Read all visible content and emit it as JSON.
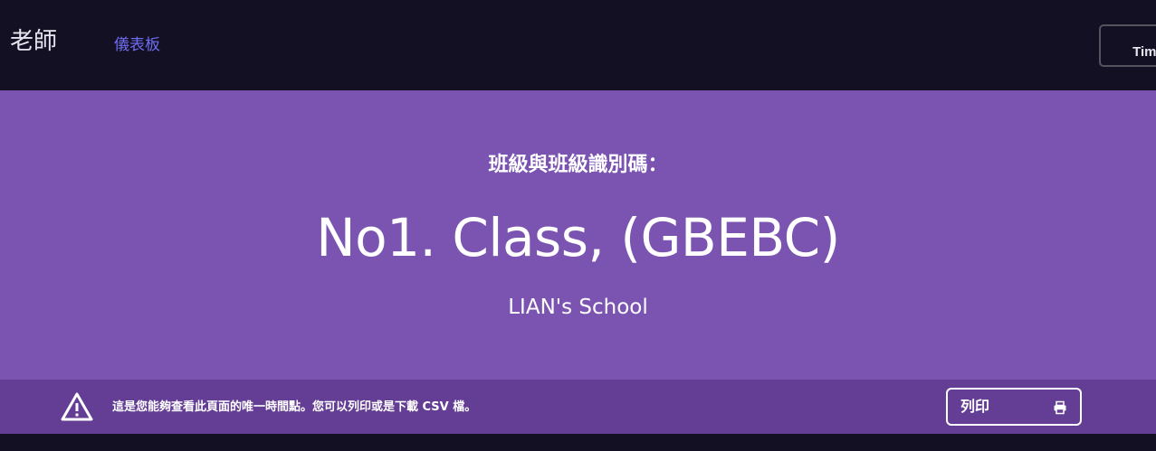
{
  "navbar": {
    "brand": "老師",
    "links": [
      {
        "label": "儀表板"
      }
    ],
    "user_button": "Timy"
  },
  "hero": {
    "label": "班級與班級識別碼：",
    "class_name": "No1. Class, (GBEBC)",
    "school": "LIAN's School"
  },
  "notice": {
    "icon": "warning-icon",
    "text": "這是您能夠查看此頁面的唯一時間點。您可以列印或是下載 CSV 檔。",
    "print_button": {
      "label": "列印",
      "icon": "printer-icon"
    }
  },
  "colors": {
    "navbar_bg": "#121022",
    "hero_bg": "#7b54b2",
    "notice_bg": "#643e94",
    "link": "#6f6ef2"
  }
}
